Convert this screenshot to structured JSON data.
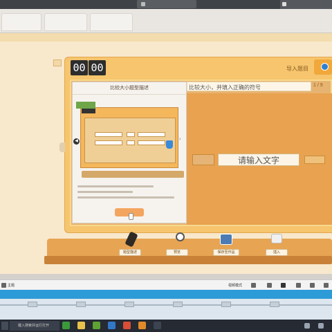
{
  "window": {
    "video_bar_label": "",
    "right_tab_label": ""
  },
  "app": {
    "band_label": ""
  },
  "toolbar": {
    "timer_min": "00",
    "timer_sec": "00",
    "import_label": "导入题目"
  },
  "question": {
    "prompt": "比较大小，并填入正确的符号",
    "page_indicator": "1 / 9"
  },
  "board": {
    "input_placeholder": "请输入文字"
  },
  "popup": {
    "title": "比较大小题型描述",
    "button_label": ""
  },
  "shelf": {
    "tools": [
      {
        "name": "题型描述",
        "icon": "pencil-icon"
      },
      {
        "name": "预览",
        "icon": "magnifier-icon"
      },
      {
        "name": "保存至作品",
        "icon": "save-icon"
      },
      {
        "name": "插入",
        "icon": "insert-icon"
      }
    ]
  },
  "media": {
    "left_label": "主题",
    "mid_label": "视频模式"
  },
  "taskbar": {
    "search_placeholder": "键入搜索并运行打开"
  },
  "colors": {
    "panel": "#f6c56d",
    "board": "#e9a24f",
    "accent_blue": "#2c9bd8",
    "taskbar": "#252a33"
  }
}
